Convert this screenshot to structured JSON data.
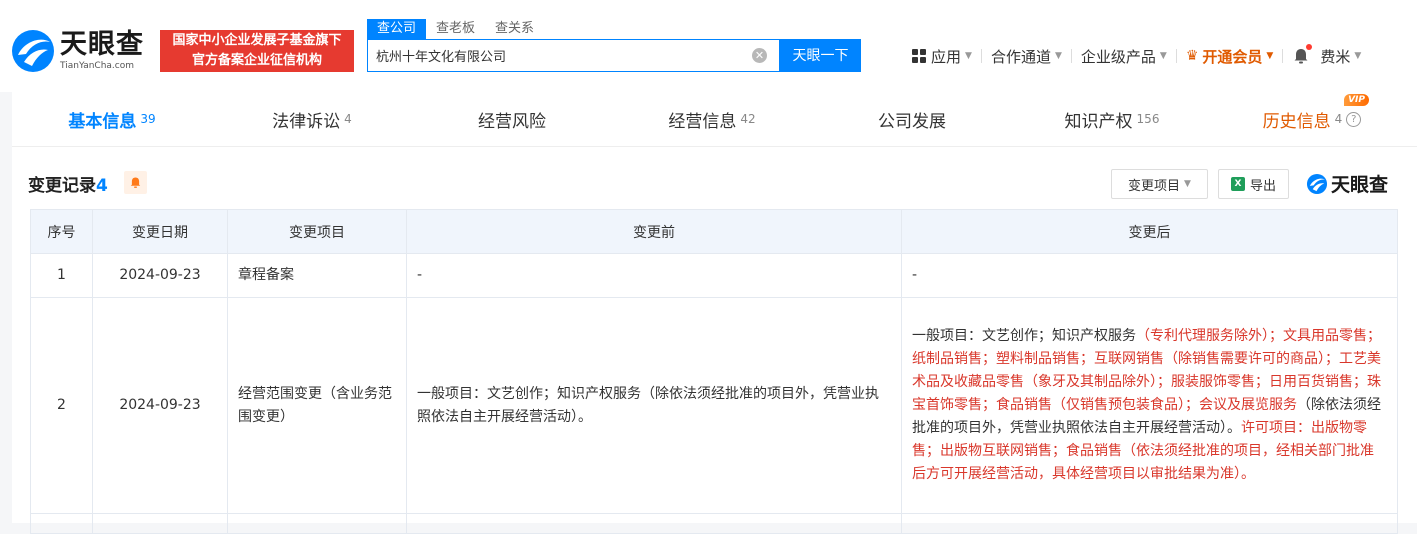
{
  "header": {
    "logo_cn": "天眼查",
    "logo_en": "TianYanCha.com",
    "banner_line1": "国家中小企业发展子基金旗下",
    "banner_line2": "官方备案企业征信机构",
    "search_tabs": [
      "查公司",
      "查老板",
      "查关系"
    ],
    "search_value": "杭州十年文化有限公司",
    "search_button": "天眼一下",
    "nav": {
      "apps": "应用",
      "channel": "合作通道",
      "enterprise": "企业级产品",
      "vip": "开通会员",
      "user": "费米"
    }
  },
  "tabs": [
    {
      "label": "基本信息",
      "count": "39"
    },
    {
      "label": "法律诉讼",
      "count": "4"
    },
    {
      "label": "经营风险",
      "count": ""
    },
    {
      "label": "经营信息",
      "count": "42"
    },
    {
      "label": "公司发展",
      "count": ""
    },
    {
      "label": "知识产权",
      "count": "156"
    },
    {
      "label": "历史信息",
      "count": "4",
      "badge": "VIP"
    }
  ],
  "section": {
    "title": "变更记录",
    "count": "4",
    "filter_button": "变更项目",
    "export_button": "导出",
    "watermark": "天眼查"
  },
  "table": {
    "headers": [
      "序号",
      "变更日期",
      "变更项目",
      "变更前",
      "变更后"
    ],
    "rows": [
      {
        "no": "1",
        "date": "2024-09-23",
        "item": "章程备案",
        "before": "-",
        "after": "-"
      },
      {
        "no": "2",
        "date": "2024-09-23",
        "item": "经营范围变更（含业务范围变更）",
        "before": "一般项目：文艺创作；知识产权服务（除依法须经批准的项目外，凭营业执照依法自主开展经营活动）。",
        "after_parts": [
          {
            "text": "一般项目：文艺创作；知识产权服务",
            "hl": false
          },
          {
            "text": "（专利代理服务除外）；文具用品零售；纸制品销售；塑料制品销售；互联网销售（除销售需要许可的商品）；工艺美术品及收藏品零售（象牙及其制品除外）；服装服饰零售；日用百货销售；珠宝首饰零售；食品销售（仅销售预包装食品）；会议及展览服务",
            "hl": true
          },
          {
            "text": "（除依法须经批准的项目外，凭营业执照依法自主开展经营活动）。",
            "hl": false
          },
          {
            "text": "许可项目：出版物零售；出版物互联网销售；食品销售（依法须经批准的项目，经相关部门批准后方可开展经营活动，具体经营项目以审批结果为准）。",
            "hl": true
          }
        ]
      }
    ]
  },
  "colors": {
    "brand_blue": "#0084ff",
    "banner_red": "#e63a30",
    "vip_orange": "#e05a00",
    "highlight_red": "#d9372b"
  }
}
